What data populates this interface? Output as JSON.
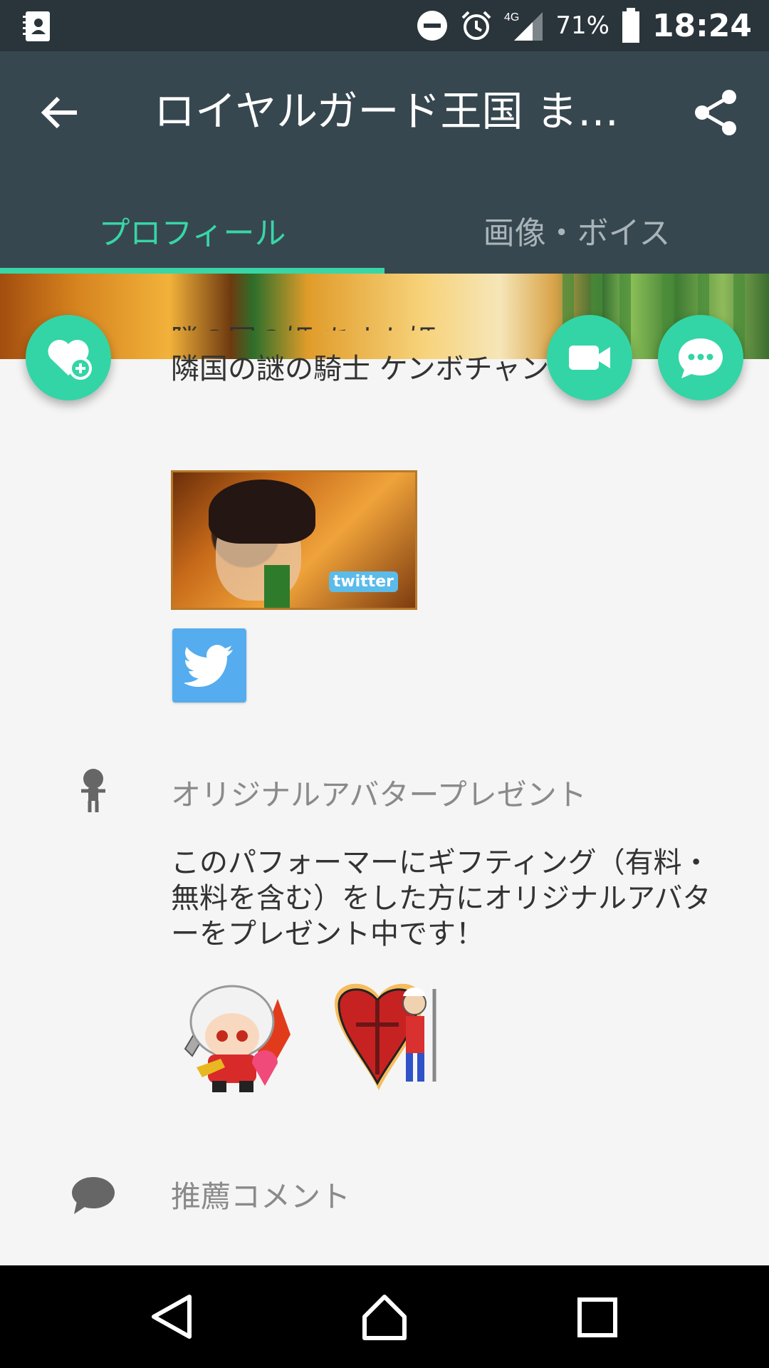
{
  "status_bar": {
    "network": "4G",
    "battery_percent": "71%",
    "time": "18:24",
    "icons": [
      "contacts-icon",
      "dnd-icon",
      "alarm-icon",
      "signal-icon",
      "battery-icon"
    ]
  },
  "app_bar": {
    "title": "ロイヤルガード王国 ま…",
    "back_icon": "back-arrow-icon",
    "share_icon": "share-icon"
  },
  "tabs": [
    {
      "label": "プロフィール",
      "active": true
    },
    {
      "label": "画像・ボイス",
      "active": false
    }
  ],
  "colors": {
    "accent": "#38d6a6",
    "appbar": "#37474f",
    "statusbar": "#2a343b",
    "twitter": "#55acee"
  },
  "fabs": {
    "favorite_icon": "heart-add-icon",
    "video_icon": "video-camera-icon",
    "chat_icon": "chat-bubble-icon"
  },
  "bio": {
    "line_cut": "隣の国の姫 あすか姫",
    "line2": "隣国の謎の騎士 ケンボチャン"
  },
  "twitter_banner": {
    "text": "twitter"
  },
  "avatar_section": {
    "label": "オリジナルアバタープレゼント",
    "icon": "avatar-figure-icon",
    "description": "このパフォーマーにギフティング（有料・無料を含む）をした方にオリジナルアバターをプレゼント中です！"
  },
  "comment_section": {
    "label": "推薦コメント",
    "icon": "comment-icon"
  },
  "nav_bar": {
    "icons": [
      "nav-back-icon",
      "nav-home-icon",
      "nav-recents-icon"
    ]
  }
}
